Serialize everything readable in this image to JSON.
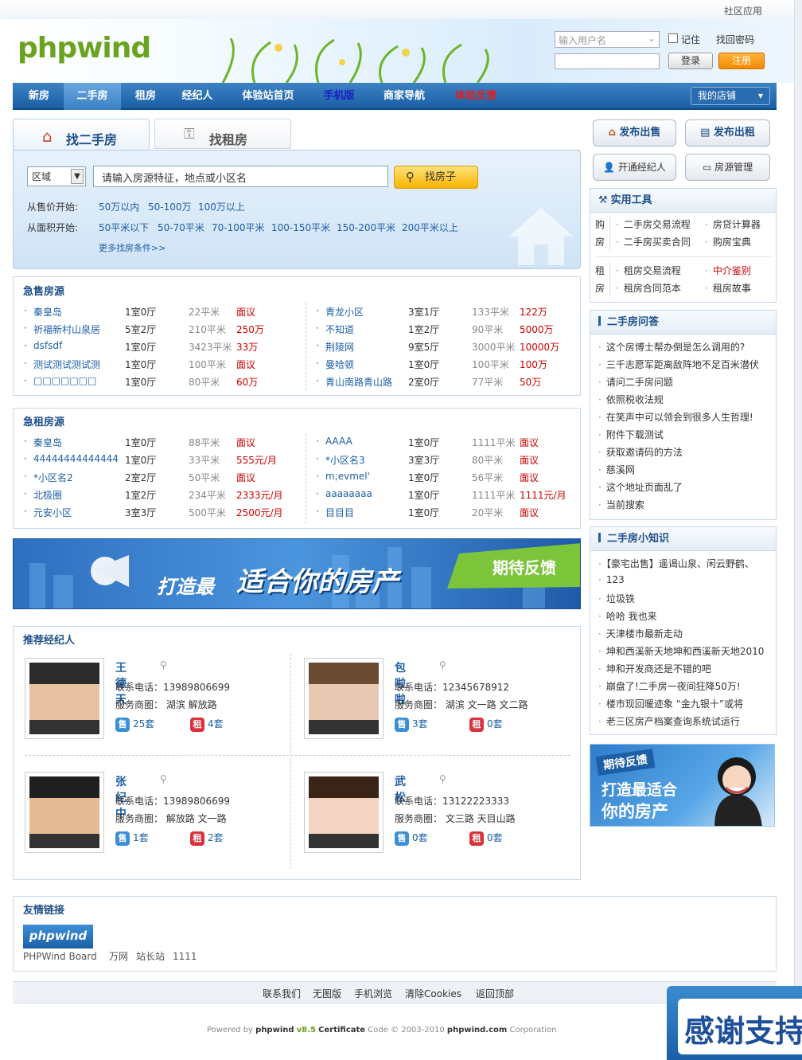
{
  "top": {
    "community_app": "社区应用"
  },
  "header": {
    "logo": "phpwind",
    "username_placeholder": "输入用户名",
    "remember": "记住",
    "find_password": "找回密码",
    "login": "登录",
    "register": "注册"
  },
  "nav": {
    "items": [
      "新房",
      "二手房",
      "租房",
      "经纪人",
      "体验站首页",
      "手机版",
      "商家导航",
      "体验反馈"
    ],
    "my_shop": "我的店铺"
  },
  "search": {
    "tab_buy": "找二手房",
    "tab_rent": "找租房",
    "region": "区域",
    "input_placeholder": "请输入房源特征，地点或小区名",
    "search_btn": "找房子",
    "price_label": "从售价开始:",
    "prices": [
      "50万以内",
      "50-100万",
      "100万以上"
    ],
    "area_label": "从面积开始:",
    "areas": [
      "50平米以下",
      "50-70平米",
      "70-100平米",
      "100-150平米",
      "150-200平米",
      "200平米以上"
    ],
    "more": "更多找房条件>>"
  },
  "actions": {
    "publish_sale": "发布出售",
    "publish_rent": "发布出租",
    "open_agent": "开通经纪人",
    "manage": "房源管理"
  },
  "tools": {
    "title": "实用工具",
    "buy_label1": "购",
    "buy_label2": "房",
    "buy": [
      "二手房交易流程",
      "房贷计算器",
      "二手房买卖合同",
      "购房宝典"
    ],
    "rent_label1": "租",
    "rent_label2": "房",
    "rent": [
      "租房交易流程",
      "中介鉴别",
      "租房合同范本",
      "租房故事"
    ]
  },
  "urgent_sale": {
    "title": "急售房源",
    "left": [
      {
        "name": "秦皇岛",
        "room": "1室0厅",
        "area": "22平米",
        "price": "面议"
      },
      {
        "name": "祈福新村山泉居",
        "room": "5室2厅",
        "area": "210平米",
        "price": "250万"
      },
      {
        "name": "dsfsdf",
        "room": "1室0厅",
        "area": "3423平米",
        "price": "33万"
      },
      {
        "name": "测试测试测试测",
        "room": "1室0厅",
        "area": "100平米",
        "price": "面议"
      },
      {
        "name": "□□□□□□□",
        "room": "1室0厅",
        "area": "80平米",
        "price": "60万"
      }
    ],
    "right": [
      {
        "name": "青龙小区",
        "room": "3室1厅",
        "area": "133平米",
        "price": "122万"
      },
      {
        "name": "不知道",
        "room": "1室2厅",
        "area": "90平米",
        "price": "5000万"
      },
      {
        "name": "荆陵网",
        "room": "9室5厅",
        "area": "3000平米",
        "price": "10000万"
      },
      {
        "name": "曼哈顿",
        "room": "1室0厅",
        "area": "100平米",
        "price": "100万"
      },
      {
        "name": "青山南路青山路",
        "room": "2室0厅",
        "area": "77平米",
        "price": "50万"
      }
    ]
  },
  "urgent_rent": {
    "title": "急租房源",
    "left": [
      {
        "name": "秦皇岛",
        "room": "1室0厅",
        "area": "88平米",
        "price": "面议"
      },
      {
        "name": "44444444444444",
        "room": "1室0厅",
        "area": "33平米",
        "price": "555元/月"
      },
      {
        "name": "*小区名2",
        "room": "2室2厅",
        "area": "50平米",
        "price": "面议"
      },
      {
        "name": "北极圈",
        "room": "1室2厅",
        "area": "234平米",
        "price": "2333元/月"
      },
      {
        "name": "元安小区",
        "room": "3室3厅",
        "area": "500平米",
        "price": "2500元/月"
      }
    ],
    "right": [
      {
        "name": "AAAA",
        "room": "1室0厅",
        "area": "1111平米",
        "price": "面议"
      },
      {
        "name": "*小区名3",
        "room": "3室3厅",
        "area": "80平米",
        "price": "面议"
      },
      {
        "name": "m;evmel'",
        "room": "1室0厅",
        "area": "56平米",
        "price": "面议"
      },
      {
        "name": "aaaaaaaa",
        "room": "1室0厅",
        "area": "1111平米",
        "price": "1111元/月"
      },
      {
        "name": "目目目",
        "room": "1室0厅",
        "area": "20平米",
        "price": "面议"
      }
    ]
  },
  "banner": {
    "text1": "打造最",
    "text2": "适合你的房产",
    "text3": "期待反馈"
  },
  "agents": {
    "title": "推荐经纪人",
    "phone_label": "联系电话：",
    "area_label": "服务商圈：",
    "list": [
      {
        "name": "王德天",
        "phone": "13989806699",
        "areas": "湖滨 解放路",
        "sale": "25套",
        "rent": "4套"
      },
      {
        "name": "包啦啦",
        "phone": "12345678912",
        "areas": "湖滨 文一路 文二路",
        "sale": "3套",
        "rent": "0套"
      },
      {
        "name": "张纪中",
        "phone": "13989806699",
        "areas": "解放路 文一路",
        "sale": "1套",
        "rent": "2套"
      },
      {
        "name": "武松",
        "phone": "13122223333",
        "areas": "文三路 天目山路",
        "sale": "0套",
        "rent": "0套"
      }
    ],
    "sale_tag": "售",
    "rent_tag": "租"
  },
  "qa": {
    "title": "二手房问答",
    "items": [
      "这个房博士帮办倒是怎么调用的?",
      "三千志愿军距离敌阵地不足百米潜伏",
      "请问二手房问题",
      "依照税收法规",
      "在笑声中可以领会到很多人生哲理!",
      "附件下载测试",
      "获取邀请码的方法",
      "慈溪网",
      "这个地址页面乱了",
      "当前搜索"
    ]
  },
  "knowledge": {
    "title": "二手房小知识",
    "items": [
      "【豪宅出售】遥谒山泉、闲云野鹤、",
      "123",
      "垃圾铁",
      "哈哈 我也来",
      "天津楼市最新走动",
      "坤和西溪新天地坤和西溪新天地2010",
      "坤和开发商还是不错的吧",
      "崩盘了!二手房一夜间狂降50万!",
      "楼市现回暖迹象 “金九银十”或将",
      "老三区房产档案查询系统试运行"
    ]
  },
  "side_banner": {
    "line1": "期待反馈",
    "line2": "打造最适合",
    "line3": "你的房产"
  },
  "links": {
    "title": "友情链接",
    "logo_text": "phpwind",
    "items": [
      "PHPWind Board",
      "万网",
      "站长站",
      "1111"
    ]
  },
  "footer": {
    "links": [
      "联系我们",
      "无图版",
      "手机浏览",
      "清除Cookies",
      "返回顶部"
    ],
    "powered": "Powered by",
    "brand": "phpwind",
    "version": "v8.5",
    "certificate": "Certificate",
    "code": "Code © 2003-2010",
    "site": "phpwind.com",
    "corp": "Corporation"
  },
  "corner": {
    "text": "感谢支持"
  }
}
